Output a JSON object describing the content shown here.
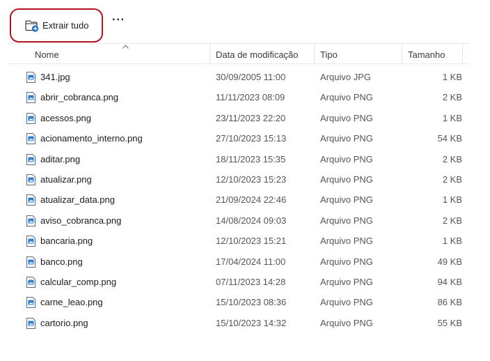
{
  "toolbar": {
    "extract_label": "Extrair tudo",
    "extract_icon": "folder-extract-icon",
    "more_label": "···",
    "highlight_color": "#b3121f"
  },
  "columns": {
    "name": "Nome",
    "date": "Data de modificação",
    "type": "Tipo",
    "size": "Tamanho"
  },
  "files": [
    {
      "name": "341.jpg",
      "date": "30/09/2005 11:00",
      "type": "Arquivo JPG",
      "size": "1 KB"
    },
    {
      "name": "abrir_cobranca.png",
      "date": "11/11/2023 08:09",
      "type": "Arquivo PNG",
      "size": "2 KB"
    },
    {
      "name": "acessos.png",
      "date": "23/11/2023 22:20",
      "type": "Arquivo PNG",
      "size": "1 KB"
    },
    {
      "name": "acionamento_interno.png",
      "date": "27/10/2023 15:13",
      "type": "Arquivo PNG",
      "size": "54 KB"
    },
    {
      "name": "aditar.png",
      "date": "18/11/2023 15:35",
      "type": "Arquivo PNG",
      "size": "2 KB"
    },
    {
      "name": "atualizar.png",
      "date": "12/10/2023 15:23",
      "type": "Arquivo PNG",
      "size": "2 KB"
    },
    {
      "name": "atualizar_data.png",
      "date": "21/09/2024 22:46",
      "type": "Arquivo PNG",
      "size": "1 KB"
    },
    {
      "name": "aviso_cobranca.png",
      "date": "14/08/2024 09:03",
      "type": "Arquivo PNG",
      "size": "2 KB"
    },
    {
      "name": "bancaria.png",
      "date": "12/10/2023 15:21",
      "type": "Arquivo PNG",
      "size": "1 KB"
    },
    {
      "name": "banco.png",
      "date": "17/04/2024 11:00",
      "type": "Arquivo PNG",
      "size": "49 KB"
    },
    {
      "name": "calcular_comp.png",
      "date": "07/11/2023 14:28",
      "type": "Arquivo PNG",
      "size": "94 KB"
    },
    {
      "name": "carne_leao.png",
      "date": "15/10/2023 08:36",
      "type": "Arquivo PNG",
      "size": "86 KB"
    },
    {
      "name": "cartorio.png",
      "date": "15/10/2023 14:32",
      "type": "Arquivo PNG",
      "size": "55 KB"
    }
  ]
}
